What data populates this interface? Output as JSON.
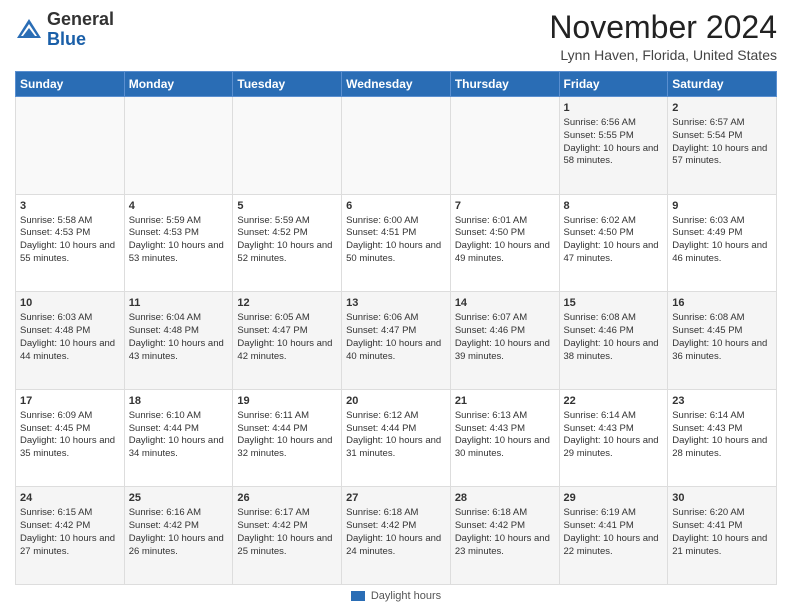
{
  "header": {
    "logo_general": "General",
    "logo_blue": "Blue",
    "month_title": "November 2024",
    "location": "Lynn Haven, Florida, United States"
  },
  "footer": {
    "legend_label": "Daylight hours"
  },
  "days_of_week": [
    "Sunday",
    "Monday",
    "Tuesday",
    "Wednesday",
    "Thursday",
    "Friday",
    "Saturday"
  ],
  "weeks": [
    [
      {
        "day": "",
        "content": ""
      },
      {
        "day": "",
        "content": ""
      },
      {
        "day": "",
        "content": ""
      },
      {
        "day": "",
        "content": ""
      },
      {
        "day": "",
        "content": ""
      },
      {
        "day": "1",
        "content": "Sunrise: 6:56 AM\nSunset: 5:55 PM\nDaylight: 10 hours and 58 minutes."
      },
      {
        "day": "2",
        "content": "Sunrise: 6:57 AM\nSunset: 5:54 PM\nDaylight: 10 hours and 57 minutes."
      }
    ],
    [
      {
        "day": "3",
        "content": "Sunrise: 5:58 AM\nSunset: 4:53 PM\nDaylight: 10 hours and 55 minutes."
      },
      {
        "day": "4",
        "content": "Sunrise: 5:59 AM\nSunset: 4:53 PM\nDaylight: 10 hours and 53 minutes."
      },
      {
        "day": "5",
        "content": "Sunrise: 5:59 AM\nSunset: 4:52 PM\nDaylight: 10 hours and 52 minutes."
      },
      {
        "day": "6",
        "content": "Sunrise: 6:00 AM\nSunset: 4:51 PM\nDaylight: 10 hours and 50 minutes."
      },
      {
        "day": "7",
        "content": "Sunrise: 6:01 AM\nSunset: 4:50 PM\nDaylight: 10 hours and 49 minutes."
      },
      {
        "day": "8",
        "content": "Sunrise: 6:02 AM\nSunset: 4:50 PM\nDaylight: 10 hours and 47 minutes."
      },
      {
        "day": "9",
        "content": "Sunrise: 6:03 AM\nSunset: 4:49 PM\nDaylight: 10 hours and 46 minutes."
      }
    ],
    [
      {
        "day": "10",
        "content": "Sunrise: 6:03 AM\nSunset: 4:48 PM\nDaylight: 10 hours and 44 minutes."
      },
      {
        "day": "11",
        "content": "Sunrise: 6:04 AM\nSunset: 4:48 PM\nDaylight: 10 hours and 43 minutes."
      },
      {
        "day": "12",
        "content": "Sunrise: 6:05 AM\nSunset: 4:47 PM\nDaylight: 10 hours and 42 minutes."
      },
      {
        "day": "13",
        "content": "Sunrise: 6:06 AM\nSunset: 4:47 PM\nDaylight: 10 hours and 40 minutes."
      },
      {
        "day": "14",
        "content": "Sunrise: 6:07 AM\nSunset: 4:46 PM\nDaylight: 10 hours and 39 minutes."
      },
      {
        "day": "15",
        "content": "Sunrise: 6:08 AM\nSunset: 4:46 PM\nDaylight: 10 hours and 38 minutes."
      },
      {
        "day": "16",
        "content": "Sunrise: 6:08 AM\nSunset: 4:45 PM\nDaylight: 10 hours and 36 minutes."
      }
    ],
    [
      {
        "day": "17",
        "content": "Sunrise: 6:09 AM\nSunset: 4:45 PM\nDaylight: 10 hours and 35 minutes."
      },
      {
        "day": "18",
        "content": "Sunrise: 6:10 AM\nSunset: 4:44 PM\nDaylight: 10 hours and 34 minutes."
      },
      {
        "day": "19",
        "content": "Sunrise: 6:11 AM\nSunset: 4:44 PM\nDaylight: 10 hours and 32 minutes."
      },
      {
        "day": "20",
        "content": "Sunrise: 6:12 AM\nSunset: 4:44 PM\nDaylight: 10 hours and 31 minutes."
      },
      {
        "day": "21",
        "content": "Sunrise: 6:13 AM\nSunset: 4:43 PM\nDaylight: 10 hours and 30 minutes."
      },
      {
        "day": "22",
        "content": "Sunrise: 6:14 AM\nSunset: 4:43 PM\nDaylight: 10 hours and 29 minutes."
      },
      {
        "day": "23",
        "content": "Sunrise: 6:14 AM\nSunset: 4:43 PM\nDaylight: 10 hours and 28 minutes."
      }
    ],
    [
      {
        "day": "24",
        "content": "Sunrise: 6:15 AM\nSunset: 4:42 PM\nDaylight: 10 hours and 27 minutes."
      },
      {
        "day": "25",
        "content": "Sunrise: 6:16 AM\nSunset: 4:42 PM\nDaylight: 10 hours and 26 minutes."
      },
      {
        "day": "26",
        "content": "Sunrise: 6:17 AM\nSunset: 4:42 PM\nDaylight: 10 hours and 25 minutes."
      },
      {
        "day": "27",
        "content": "Sunrise: 6:18 AM\nSunset: 4:42 PM\nDaylight: 10 hours and 24 minutes."
      },
      {
        "day": "28",
        "content": "Sunrise: 6:18 AM\nSunset: 4:42 PM\nDaylight: 10 hours and 23 minutes."
      },
      {
        "day": "29",
        "content": "Sunrise: 6:19 AM\nSunset: 4:41 PM\nDaylight: 10 hours and 22 minutes."
      },
      {
        "day": "30",
        "content": "Sunrise: 6:20 AM\nSunset: 4:41 PM\nDaylight: 10 hours and 21 minutes."
      }
    ]
  ]
}
